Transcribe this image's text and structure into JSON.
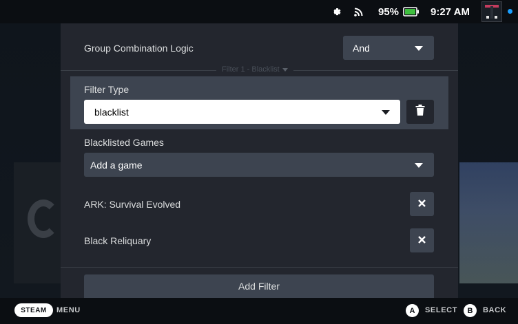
{
  "status_bar": {
    "battery_percent": "95%",
    "time": "9:27 AM",
    "icons": [
      "gear-icon",
      "wifi-icon",
      "battery-icon",
      "avatar",
      "notification-dot"
    ],
    "notification_color": "#1a9fff"
  },
  "panel": {
    "group_logic": {
      "label": "Group Combination Logic",
      "value": "And"
    },
    "section": {
      "title": "Filter 1 - Blacklist"
    },
    "filter_type": {
      "label": "Filter Type",
      "value": "blacklist"
    },
    "blacklisted": {
      "label": "Blacklisted Games",
      "add_placeholder": "Add a game",
      "games": [
        {
          "name": "ARK: Survival Evolved"
        },
        {
          "name": "Black Reliquary"
        }
      ]
    },
    "add_filter_label": "Add Filter"
  },
  "footer": {
    "steam_label": "STEAM",
    "menu_label": "MENU",
    "a_label": "A",
    "select_label": "SELECT",
    "b_label": "B",
    "back_label": "BACK"
  },
  "colors": {
    "panel_bg": "#23262e",
    "control_bg": "#3d4450",
    "accent": "#1a9fff"
  }
}
